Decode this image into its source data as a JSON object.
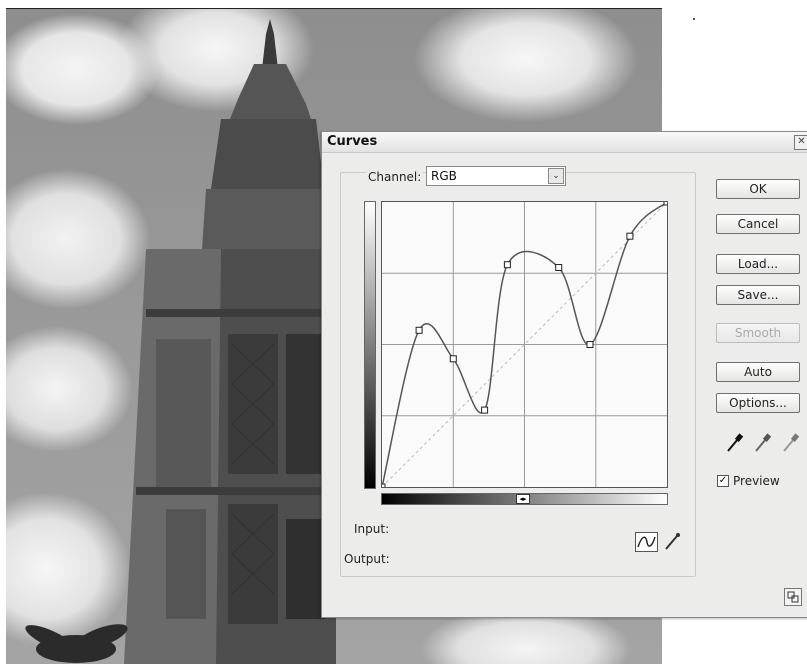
{
  "dialog": {
    "title": "Curves",
    "close_glyph": "✕",
    "channel_label": "Channel:",
    "channel_value": "RGB",
    "channel_arrow": "⌄",
    "input_label": "Input:",
    "output_label": "Output:",
    "preview_label": "Preview",
    "preview_checked": "✓"
  },
  "buttons": {
    "ok": "OK",
    "cancel": "Cancel",
    "load": "Load...",
    "save": "Save...",
    "smooth": "Smooth",
    "auto": "Auto",
    "options": "Options..."
  },
  "icons": {
    "eyedroppers": [
      "black-point-eyedropper-icon",
      "gray-point-eyedropper-icon",
      "white-point-eyedropper-icon"
    ],
    "curve_tool": "curve-point-icon",
    "pencil_tool": "pencil-icon",
    "resize": "resize-icon"
  },
  "curve": {
    "points": [
      [
        0,
        0
      ],
      [
        13,
        55
      ],
      [
        25,
        45
      ],
      [
        36,
        27
      ],
      [
        44,
        78
      ],
      [
        62,
        77
      ],
      [
        73,
        50
      ],
      [
        87,
        88
      ],
      [
        100,
        100
      ]
    ]
  }
}
